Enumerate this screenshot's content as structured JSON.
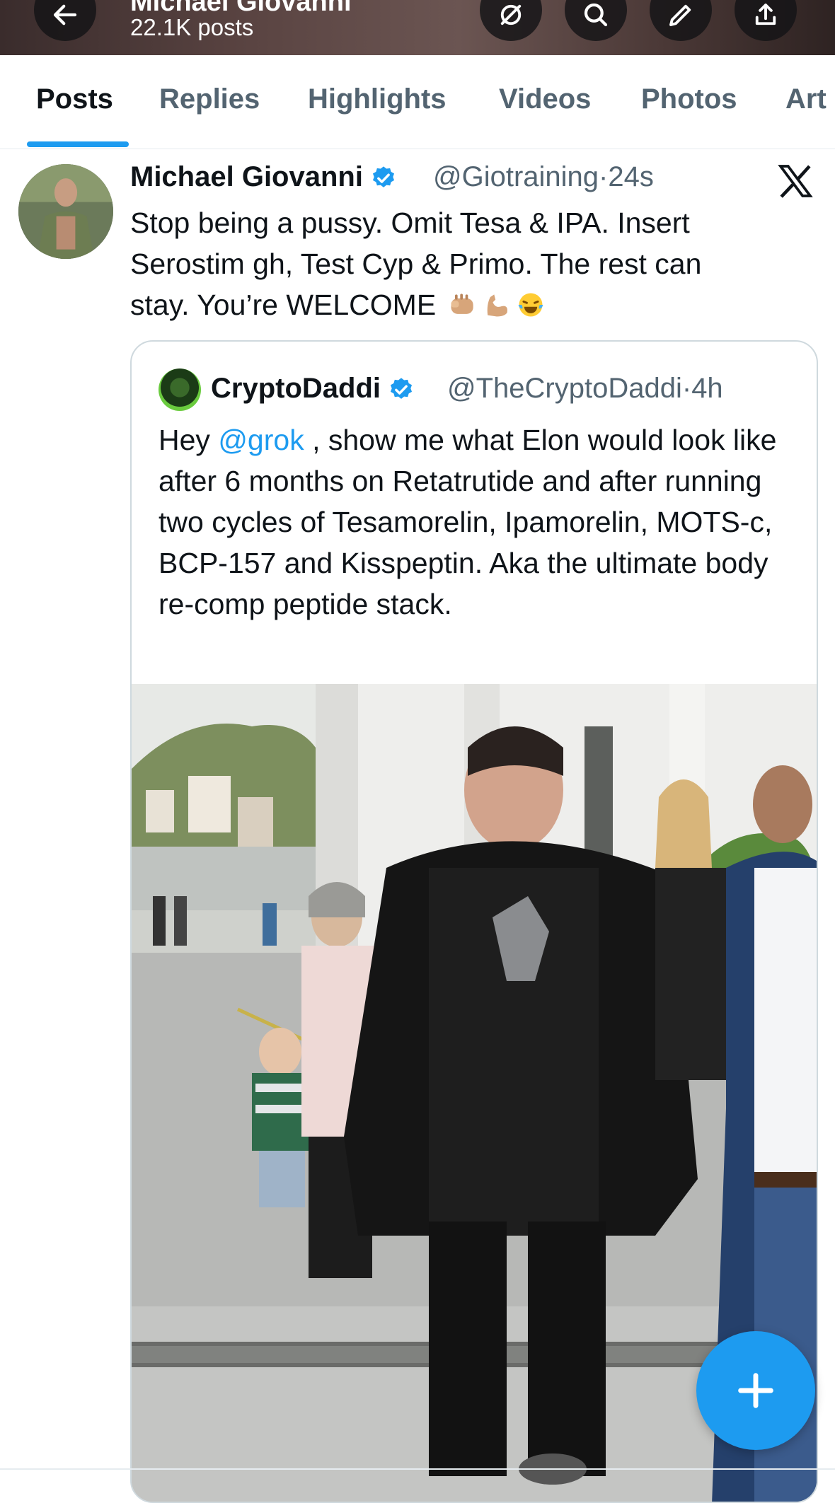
{
  "header": {
    "title": "Michael Giovanni",
    "posts_count": "22.1K posts",
    "buttons": [
      "back-arrow-icon",
      "grok-icon",
      "search-icon",
      "edit-icon",
      "share-icon"
    ]
  },
  "tabs": [
    {
      "label": "Posts",
      "active": true
    },
    {
      "label": "Replies",
      "active": false
    },
    {
      "label": "Highlights",
      "active": false
    },
    {
      "label": "Videos",
      "active": false
    },
    {
      "label": "Photos",
      "active": false
    },
    {
      "label": "Art",
      "active": false
    }
  ],
  "post": {
    "author": "Michael Giovanni",
    "handle": "@Giotraining",
    "separator": "·",
    "time": "24s",
    "text": "Stop being a pussy. Omit Tesa & IPA. Insert Serostim gh, Test Cyp & Primo. The rest can stay. You’re WELCOME",
    "emojis": [
      "fist-emoji",
      "flexed-biceps-emoji",
      "laughing-tears-emoji"
    ]
  },
  "quote": {
    "author": "CryptoDaddi",
    "handle": "@TheCryptoDaddi",
    "separator": "·",
    "time": "4h",
    "text_prefix": "Hey ",
    "mention": "@grok",
    "text_body": " ,  show me what Elon would look like after 6 months on Retatrutide and after running two cycles of Tesamorelin, Ipamorelin, MOTS-c, BCP-157 and Kisspeptin.  Aka the ultimate body re-comp peptide stack."
  },
  "colors": {
    "accent": "#1d9bf0",
    "text_primary": "#0f1419",
    "text_secondary": "#536471",
    "border": "#cfd9de"
  },
  "fab": {
    "icon": "plus-icon"
  }
}
